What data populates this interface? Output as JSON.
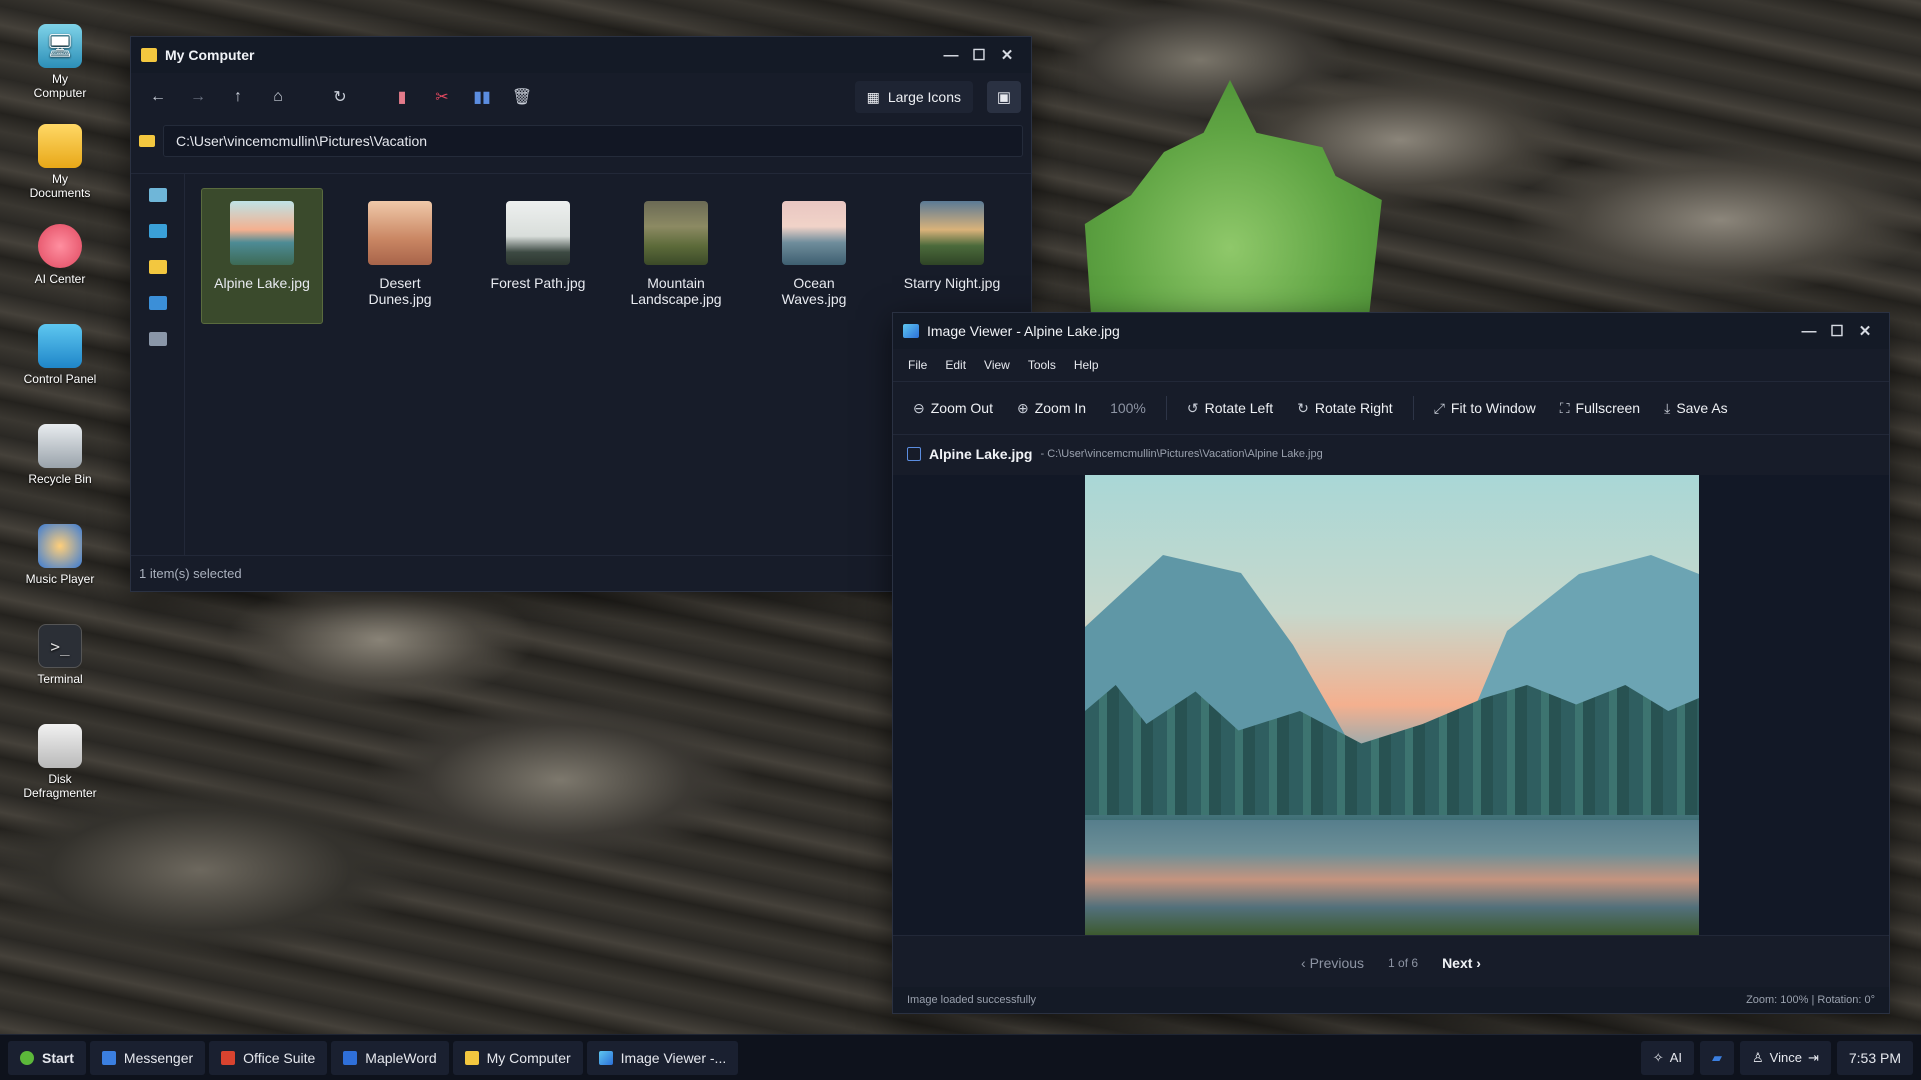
{
  "desktop": {
    "icons": [
      {
        "label": "My\nComputer",
        "line1": "My",
        "line2": "Computer",
        "icon": "computer-icon"
      },
      {
        "label": "My Documents",
        "line1": "My",
        "line2": "Documents",
        "icon": "folder-icon"
      },
      {
        "label": "AI Center",
        "line1": "AI Center",
        "line2": "",
        "icon": "brain-icon"
      },
      {
        "label": "Control Panel",
        "line1": "Control Panel",
        "line2": "",
        "icon": "control-panel-icon"
      },
      {
        "label": "Recycle Bin",
        "line1": "Recycle Bin",
        "line2": "",
        "icon": "recycle-bin-icon"
      },
      {
        "label": "Music Player",
        "line1": "Music Player",
        "line2": "",
        "icon": "music-player-icon"
      },
      {
        "label": "Terminal",
        "line1": "Terminal",
        "line2": "",
        "icon": "terminal-icon"
      },
      {
        "label": "Disk Defragmenter",
        "line1": "Disk",
        "line2": "Defragmenter",
        "icon": "disk-icon"
      }
    ]
  },
  "explorer": {
    "title": "My Computer",
    "view_label": "Large Icons",
    "path": "C:\\User\\vincemcmullin\\Pictures\\Vacation",
    "status": "1 item(s) selected",
    "files": [
      {
        "line1": "Alpine Lake.jpg",
        "line2": "",
        "selected": true
      },
      {
        "line1": "Desert",
        "line2": "Dunes.jpg",
        "selected": false
      },
      {
        "line1": "Forest Path.jpg",
        "line2": "",
        "selected": false
      },
      {
        "line1": "Mountain",
        "line2": "Landscape.jpg",
        "selected": false
      },
      {
        "line1": "Ocean",
        "line2": "Waves.jpg",
        "selected": false
      },
      {
        "line1": "Starry Night.jpg",
        "line2": "",
        "selected": false
      }
    ]
  },
  "viewer": {
    "title": "Image Viewer - Alpine Lake.jpg",
    "menu": [
      "File",
      "Edit",
      "View",
      "Tools",
      "Help"
    ],
    "toolbar": {
      "zoom_out": "Zoom Out",
      "zoom_in": "Zoom In",
      "zoom_value": "100%",
      "rotate_left": "Rotate Left",
      "rotate_right": "Rotate Right",
      "fit": "Fit to Window",
      "fullscreen": "Fullscreen",
      "save_as": "Save As"
    },
    "file_name": "Alpine Lake.jpg",
    "file_path": "- C:\\User\\vincemcmullin\\Pictures\\Vacation\\Alpine Lake.jpg",
    "nav": {
      "previous": "Previous",
      "page": "1 of 6",
      "next": "Next"
    },
    "status_left": "Image loaded successfully",
    "status_right": "Zoom: 100% | Rotation: 0°"
  },
  "taskbar": {
    "start": "Start",
    "items": [
      "Messenger",
      "Office Suite",
      "MapleWord",
      "My Computer",
      "Image Viewer -..."
    ],
    "ai_label": "AI",
    "user": "Vince",
    "time": "7:53 PM"
  }
}
